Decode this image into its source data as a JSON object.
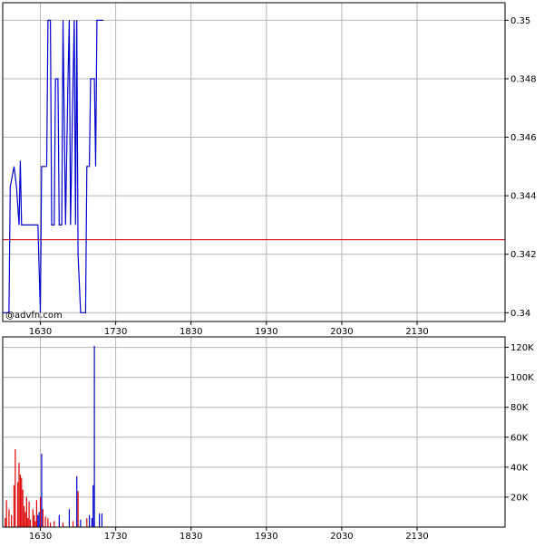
{
  "watermark": "@advfn.com",
  "colors": {
    "price_line": "#0000cc",
    "reference_line": "#dd0000",
    "grid": "#b4b4b4",
    "frame": "#000000",
    "volume_down": "#dd0000",
    "volume_up": "#0000cc"
  },
  "chart_data": [
    {
      "type": "line",
      "name": "price",
      "x_ticks": [
        "1630",
        "1730",
        "1830",
        "1930",
        "2030",
        "2130"
      ],
      "y_ticks": [
        "0.34",
        "0.342",
        "0.344",
        "0.346",
        "0.348",
        "0.35"
      ],
      "ylim": [
        0.3397,
        0.3506
      ],
      "xlim_minutes": [
        960,
        1360
      ],
      "grid": true,
      "reference_value": 0.3425,
      "points": [
        [
          960,
          0.34
        ],
        [
          965,
          0.34
        ],
        [
          966,
          0.3443
        ],
        [
          969,
          0.345
        ],
        [
          971,
          0.3443
        ],
        [
          973,
          0.343
        ],
        [
          974,
          0.3452
        ],
        [
          975,
          0.343
        ],
        [
          981,
          0.343
        ],
        [
          988,
          0.343
        ],
        [
          990,
          0.34
        ],
        [
          991,
          0.345
        ],
        [
          995,
          0.345
        ],
        [
          996,
          0.35
        ],
        [
          998,
          0.35
        ],
        [
          999,
          0.343
        ],
        [
          1001,
          0.343
        ],
        [
          1002,
          0.348
        ],
        [
          1004,
          0.348
        ],
        [
          1005,
          0.343
        ],
        [
          1007,
          0.343
        ],
        [
          1008,
          0.35
        ],
        [
          1010,
          0.343
        ],
        [
          1012,
          0.348
        ],
        [
          1013,
          0.35
        ],
        [
          1014,
          0.343
        ],
        [
          1016,
          0.348
        ],
        [
          1017,
          0.35
        ],
        [
          1018,
          0.343
        ],
        [
          1019,
          0.35
        ],
        [
          1020,
          0.342
        ],
        [
          1022,
          0.34
        ],
        [
          1026,
          0.34
        ],
        [
          1027,
          0.345
        ],
        [
          1029,
          0.345
        ],
        [
          1030,
          0.348
        ],
        [
          1033,
          0.348
        ],
        [
          1034,
          0.345
        ],
        [
          1035,
          0.35
        ],
        [
          1040,
          0.35
        ]
      ]
    },
    {
      "type": "bar",
      "name": "volume",
      "x_ticks": [
        "1630",
        "1730",
        "1830",
        "1930",
        "2030",
        "2130"
      ],
      "y_ticks": [
        "20K",
        "40K",
        "60K",
        "80K",
        "100K",
        "120K"
      ],
      "ylim": [
        0,
        127000
      ],
      "bars": [
        {
          "t": 962,
          "v": 6000,
          "d": "down"
        },
        {
          "t": 963,
          "v": 18000,
          "d": "down"
        },
        {
          "t": 965,
          "v": 12000,
          "d": "down"
        },
        {
          "t": 967,
          "v": 8000,
          "d": "down"
        },
        {
          "t": 969,
          "v": 28000,
          "d": "down"
        },
        {
          "t": 970,
          "v": 52000,
          "d": "down"
        },
        {
          "t": 972,
          "v": 30000,
          "d": "down"
        },
        {
          "t": 973,
          "v": 43000,
          "d": "down"
        },
        {
          "t": 974,
          "v": 35000,
          "d": "down"
        },
        {
          "t": 975,
          "v": 33000,
          "d": "down"
        },
        {
          "t": 976,
          "v": 25000,
          "d": "down"
        },
        {
          "t": 977,
          "v": 14000,
          "d": "down"
        },
        {
          "t": 978,
          "v": 10000,
          "d": "down"
        },
        {
          "t": 979,
          "v": 20000,
          "d": "down"
        },
        {
          "t": 980,
          "v": 6000,
          "d": "down"
        },
        {
          "t": 981,
          "v": 17000,
          "d": "down"
        },
        {
          "t": 982,
          "v": 5000,
          "d": "down"
        },
        {
          "t": 984,
          "v": 12000,
          "d": "down"
        },
        {
          "t": 985,
          "v": 8000,
          "d": "down"
        },
        {
          "t": 986,
          "v": 4000,
          "d": "down"
        },
        {
          "t": 987,
          "v": 18000,
          "d": "down"
        },
        {
          "t": 988,
          "v": 8000,
          "d": "up"
        },
        {
          "t": 989,
          "v": 10000,
          "d": "up"
        },
        {
          "t": 990,
          "v": 20000,
          "d": "down"
        },
        {
          "t": 991,
          "v": 49000,
          "d": "up"
        },
        {
          "t": 992,
          "v": 12000,
          "d": "down"
        },
        {
          "t": 994,
          "v": 7000,
          "d": "down"
        },
        {
          "t": 996,
          "v": 6000,
          "d": "down"
        },
        {
          "t": 998,
          "v": 3000,
          "d": "down"
        },
        {
          "t": 1001,
          "v": 4000,
          "d": "down"
        },
        {
          "t": 1005,
          "v": 8000,
          "d": "up"
        },
        {
          "t": 1008,
          "v": 3000,
          "d": "down"
        },
        {
          "t": 1013,
          "v": 12000,
          "d": "up"
        },
        {
          "t": 1016,
          "v": 4000,
          "d": "down"
        },
        {
          "t": 1019,
          "v": 34000,
          "d": "up"
        },
        {
          "t": 1020,
          "v": 24000,
          "d": "down"
        },
        {
          "t": 1022,
          "v": 5000,
          "d": "up"
        },
        {
          "t": 1027,
          "v": 6000,
          "d": "down"
        },
        {
          "t": 1029,
          "v": 8000,
          "d": "up"
        },
        {
          "t": 1031,
          "v": 6000,
          "d": "up"
        },
        {
          "t": 1032,
          "v": 28000,
          "d": "up"
        },
        {
          "t": 1033,
          "v": 121000,
          "d": "up"
        },
        {
          "t": 1037,
          "v": 9000,
          "d": "up"
        },
        {
          "t": 1039,
          "v": 9000,
          "d": "up"
        }
      ]
    }
  ]
}
